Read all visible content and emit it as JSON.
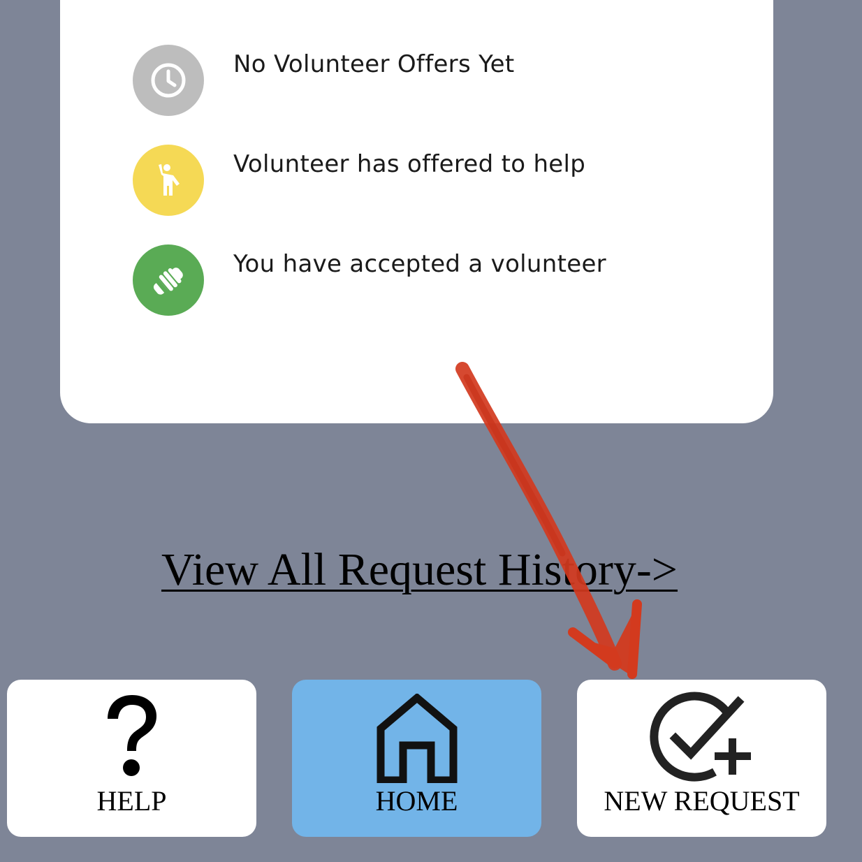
{
  "legend": {
    "items": [
      {
        "icon": "clock-icon",
        "color": "#bdbdbd",
        "label": "No Volunteer Offers Yet"
      },
      {
        "icon": "volunteer-waving-icon",
        "color": "#f5d955",
        "label": "Volunteer has offered to help"
      },
      {
        "icon": "handshake-icon",
        "color": "#5aab55",
        "label": "You have accepted a volunteer"
      }
    ]
  },
  "history_link": {
    "label": "View All Request History->"
  },
  "bottom_nav": {
    "items": [
      {
        "icon": "question-mark-icon",
        "label": "HELP",
        "active": false
      },
      {
        "icon": "home-icon",
        "label": "HOME",
        "active": true
      },
      {
        "icon": "check-circle-plus-icon",
        "label": "NEW REQUEST",
        "active": false
      }
    ]
  },
  "colors": {
    "background": "#7e8597",
    "card": "#ffffff",
    "active_nav": "#72b4e8",
    "annotation_arrow": "#d33a1e"
  }
}
